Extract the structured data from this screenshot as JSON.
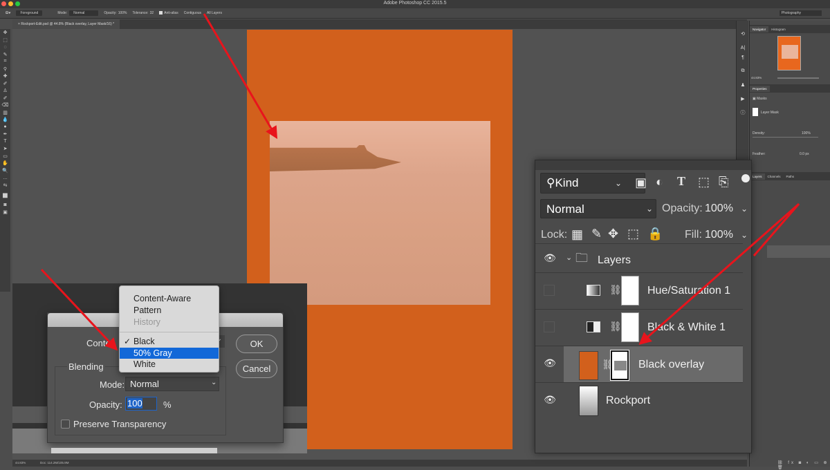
{
  "app": {
    "window_title": "Adobe Photoshop CC 2015.5",
    "workspace": "Photography"
  },
  "options_bar": {
    "tool_icon": "paint-bucket-icon",
    "fill_source": "Foreground",
    "mode_label": "Mode:",
    "mode_value": "Normal",
    "opacity_label": "Opacity:",
    "opacity_value": "100%",
    "tolerance_label": "Tolerance:",
    "tolerance_value": "32",
    "anti_alias_label": "Anti-alias",
    "contiguous_label": "Contiguous",
    "all_layers_label": "All Layers"
  },
  "document_tab": {
    "label": "Rockport-Edit.psd @ 44.8% (Black overlay, Layer Mask/16) *"
  },
  "status_bar": {
    "zoom": "44.83%",
    "doc_size": "Doc: 114.2M/105.9M"
  },
  "tools": [
    "move-icon",
    "marquee-icon",
    "lasso-icon",
    "quick-select-icon",
    "crop-icon",
    "eyedropper-icon",
    "healing-brush-icon",
    "brush-icon",
    "clone-stamp-icon",
    "history-brush-icon",
    "eraser-icon",
    "gradient-icon",
    "blur-icon",
    "dodge-icon",
    "pen-icon",
    "type-icon",
    "path-select-icon",
    "shape-icon",
    "hand-icon",
    "zoom-icon",
    "more-tools-icon",
    "swap-colors-icon",
    "color-swatches-icon",
    "quick-mask-icon",
    "screen-mode-icon"
  ],
  "tool_glyphs": [
    "✥",
    "⬚",
    "◌",
    "✎",
    "⌗",
    "⚲",
    "✚",
    "✐",
    "♙",
    "✐",
    "⌫",
    "▥",
    "💧",
    "●",
    "✒",
    "T",
    "➤",
    "▭",
    "✋",
    "🔍",
    "…",
    "⇆",
    "■",
    "◙",
    "▣"
  ],
  "navigator": {
    "tabs": [
      "Navigator",
      "Histogram"
    ],
    "zoom": "44.83%"
  },
  "properties": {
    "title": "Properties",
    "section": "Masks",
    "mask_label": "Layer Mask",
    "density_label": "Density:",
    "density_value": "100%",
    "feather_label": "Feather:",
    "feather_value": "0.0 px"
  },
  "small_layers_panel": {
    "tabs": [
      "Layers",
      "Channels",
      "Paths"
    ]
  },
  "layers_panel": {
    "filter_kind": "Kind",
    "blend_mode": "Normal",
    "opacity_label": "Opacity:",
    "opacity_value": "100%",
    "lock_label": "Lock:",
    "fill_label": "Fill:",
    "fill_value": "100%",
    "layers": [
      {
        "name": "Layers",
        "type": "group",
        "visible": true,
        "expanded": true
      },
      {
        "name": "Hue/Saturation 1",
        "type": "adjustment-hue-saturation",
        "visible": false
      },
      {
        "name": "Black & White 1",
        "type": "adjustment-black-white",
        "visible": false
      },
      {
        "name": "Black overlay",
        "type": "fill",
        "visible": true,
        "selected": true,
        "fill_color": "#d2601c"
      },
      {
        "name": "Rockport",
        "type": "smart-object",
        "visible": true
      }
    ]
  },
  "fill_dialog": {
    "contents_label": "Contents:",
    "contents_display": "Conten",
    "blending_label": "Blending",
    "mode_label": "Mode:",
    "mode_value": "Normal",
    "opacity_label": "Opacity:",
    "opacity_value": "100",
    "percent": "%",
    "preserve_transparency_label": "Preserve Transparency",
    "preserve_transparency_checked": false,
    "ok_label": "OK",
    "cancel_label": "Cancel"
  },
  "contents_dropdown": {
    "options": [
      {
        "label": "Content-Aware",
        "enabled": true
      },
      {
        "label": "Pattern",
        "enabled": true
      },
      {
        "label": "History",
        "enabled": false
      },
      {
        "label": "Black",
        "enabled": true,
        "checked": true
      },
      {
        "label": "50% Gray",
        "enabled": true,
        "highlighted": true
      },
      {
        "label": "White",
        "enabled": true
      }
    ],
    "check_glyph": "✓"
  },
  "colors": {
    "document_fill": "#d2601c",
    "highlight": "#1268d8",
    "annotation_arrow": "#e8141c"
  }
}
